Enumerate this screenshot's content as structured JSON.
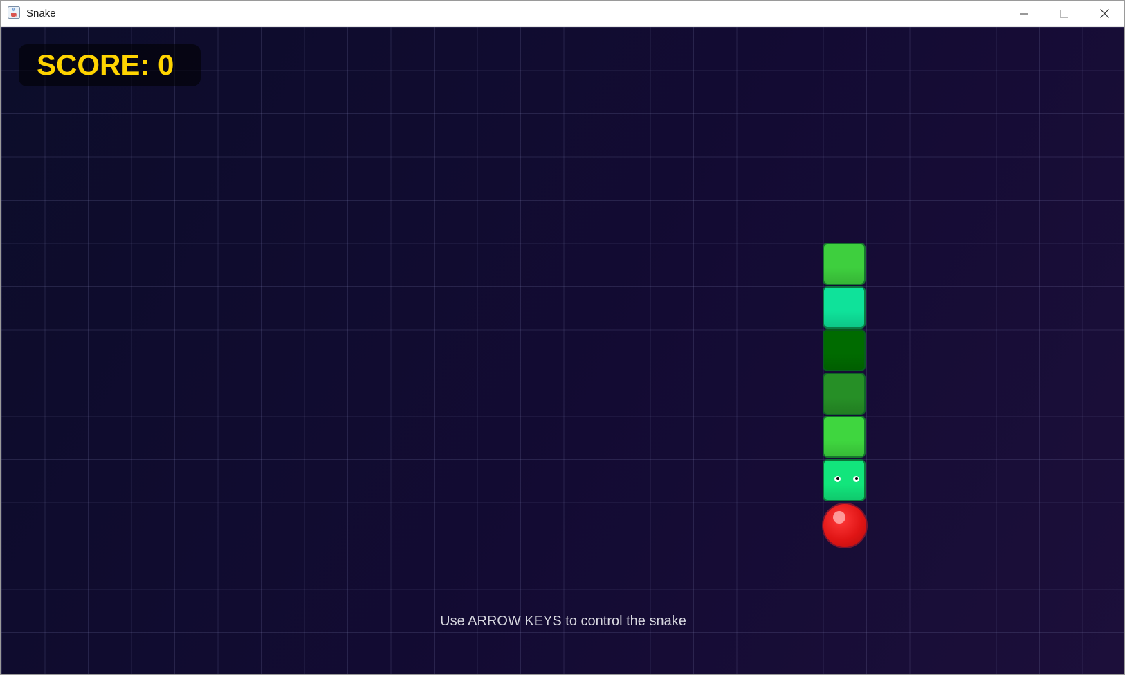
{
  "window": {
    "title": "Snake",
    "icon": "java-cup-icon"
  },
  "controls": {
    "minimize_icon": "minimize-icon",
    "maximize_icon": "maximize-icon",
    "close_icon": "close-icon"
  },
  "game": {
    "score_text": "SCORE: 0",
    "instructions": "Use ARROW KEYS to control the snake",
    "snake_direction": "down",
    "snake_segments": [
      {
        "role": "tail",
        "color": "#3ecf3e"
      },
      {
        "role": "body",
        "color": "#0fe29a"
      },
      {
        "role": "body",
        "color": "#006b00"
      },
      {
        "role": "body",
        "color": "#268f26"
      },
      {
        "role": "body",
        "color": "#3fd63f"
      },
      {
        "role": "head",
        "color": "#12e57c"
      }
    ],
    "food_color": "#e01515",
    "score_color": "#ffd400"
  }
}
